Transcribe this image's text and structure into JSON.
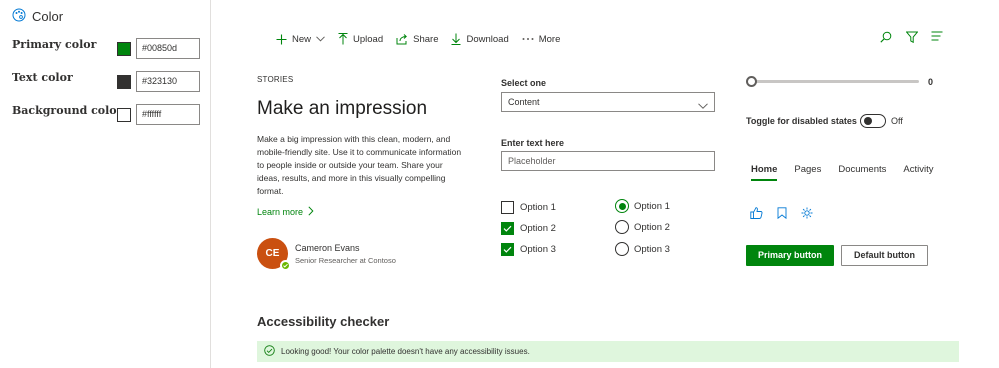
{
  "sidebar": {
    "title": "Color",
    "rows": [
      {
        "label": "Primary color",
        "hex": "#00850d",
        "swatch": "#00850d"
      },
      {
        "label": "Text color",
        "hex": "#323130",
        "swatch": "#323130"
      },
      {
        "label": "Background color",
        "hex": "#ffffff",
        "swatch": "#ffffff"
      }
    ]
  },
  "toolbar": {
    "new_label": "New",
    "upload_label": "Upload",
    "share_label": "Share",
    "download_label": "Download",
    "more_label": "More"
  },
  "stories": {
    "eyebrow": "STORIES",
    "headline": "Make an impression",
    "body": "Make a big impression with this clean, modern, and mobile-friendly site. Use it to communicate information to people inside or outside your team. Share your ideas, results, and more in this visually compelling format.",
    "learn_more": "Learn more",
    "persona": {
      "initials": "CE",
      "name": "Cameron Evans",
      "role": "Senior Researcher at Contoso"
    }
  },
  "form": {
    "select_label": "Select one",
    "select_value": "Content",
    "text_label": "Enter text here",
    "text_placeholder": "Placeholder",
    "checkboxes": [
      {
        "label": "Option 1",
        "checked": false
      },
      {
        "label": "Option 2",
        "checked": true
      },
      {
        "label": "Option 3",
        "checked": true
      }
    ],
    "radios": [
      {
        "label": "Option 1",
        "checked": true
      },
      {
        "label": "Option 2",
        "checked": false
      },
      {
        "label": "Option 3",
        "checked": false
      }
    ]
  },
  "controls": {
    "slider_value": "0",
    "toggle_label": "Toggle for disabled states",
    "toggle_state": "Off",
    "tabs": [
      "Home",
      "Pages",
      "Documents",
      "Activity"
    ],
    "primary_button": "Primary button",
    "default_button": "Default button"
  },
  "accessibility": {
    "title": "Accessibility checker",
    "message": "Looking good! Your color palette doesn't have any accessibility issues."
  },
  "colors": {
    "primary": "#00850d",
    "text": "#323130",
    "success_bg": "#dff6dd"
  }
}
